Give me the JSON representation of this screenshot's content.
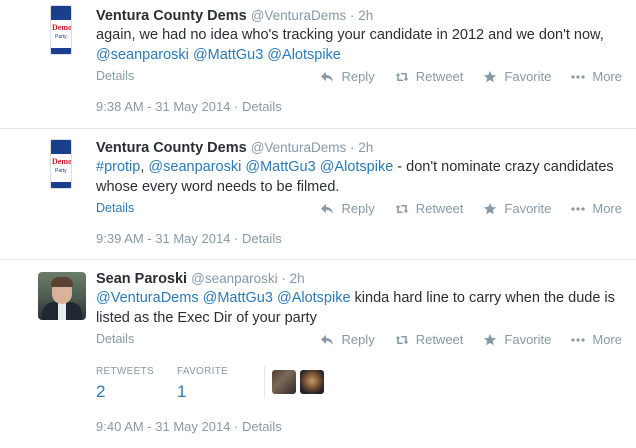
{
  "tweets": [
    {
      "fullname": "Ventura County Dems",
      "handle": "@VenturaDems",
      "sep": " · ",
      "time": "2h",
      "avatar_lines": [
        "Ventura Co.",
        "Democ",
        "Party"
      ],
      "text": [
        {
          "t": "again, we had no idea who's tracking your candidate in 2012 and we don't now, ",
          "link": false
        },
        {
          "t": "@seanparoski",
          "link": true
        },
        {
          "t": " ",
          "link": false
        },
        {
          "t": "@MattGu3",
          "link": true
        },
        {
          "t": " ",
          "link": false
        },
        {
          "t": "@Alotspike",
          "link": true
        }
      ],
      "details_label": "Details",
      "stamp": "9:38 AM - 31 May 2014 · Details"
    },
    {
      "fullname": "Ventura County Dems",
      "handle": "@VenturaDems",
      "sep": " · ",
      "time": "2h",
      "avatar_lines": [
        "Ventura Co.",
        "Democ",
        "Party"
      ],
      "text": [
        {
          "t": "#protip",
          "link": true
        },
        {
          "t": ", ",
          "link": false
        },
        {
          "t": "@seanparoski",
          "link": true
        },
        {
          "t": " ",
          "link": false
        },
        {
          "t": "@MattGu3",
          "link": true
        },
        {
          "t": " ",
          "link": false
        },
        {
          "t": "@Alotspike",
          "link": true
        },
        {
          "t": " - don't nominate crazy candidates whose every word needs to be filmed.",
          "link": false
        }
      ],
      "details_label": "Details",
      "stamp": "9:39 AM - 31 May 2014 · Details"
    },
    {
      "fullname": "Sean Paroski",
      "handle": "@seanparoski",
      "sep": " · ",
      "time": "2h",
      "text": [
        {
          "t": "@VenturaDems",
          "link": true
        },
        {
          "t": " ",
          "link": false
        },
        {
          "t": "@MattGu3",
          "link": true
        },
        {
          "t": " ",
          "link": false
        },
        {
          "t": "@Alotspike",
          "link": true
        },
        {
          "t": " kinda hard line to carry when the dude is listed as the Exec Dir of your party",
          "link": false
        }
      ],
      "details_label": "Details",
      "stamp": "9:40 AM - 31 May 2014 · Details",
      "stats": {
        "retweets_label": "RETWEETS",
        "retweets": "2",
        "favorites_label": "FAVORITE",
        "favorites": "1"
      }
    }
  ],
  "actions": {
    "reply": "Reply",
    "retweet": "Retweet",
    "favorite": "Favorite",
    "more": "More"
  },
  "icons": [
    "reply-icon",
    "retweet-icon",
    "favorite-star-icon",
    "more-dots-icon"
  ],
  "colors": {
    "link": "#2b7bb9",
    "muted": "#8899a6",
    "text": "#292f33",
    "divider": "#e1e8ed"
  }
}
